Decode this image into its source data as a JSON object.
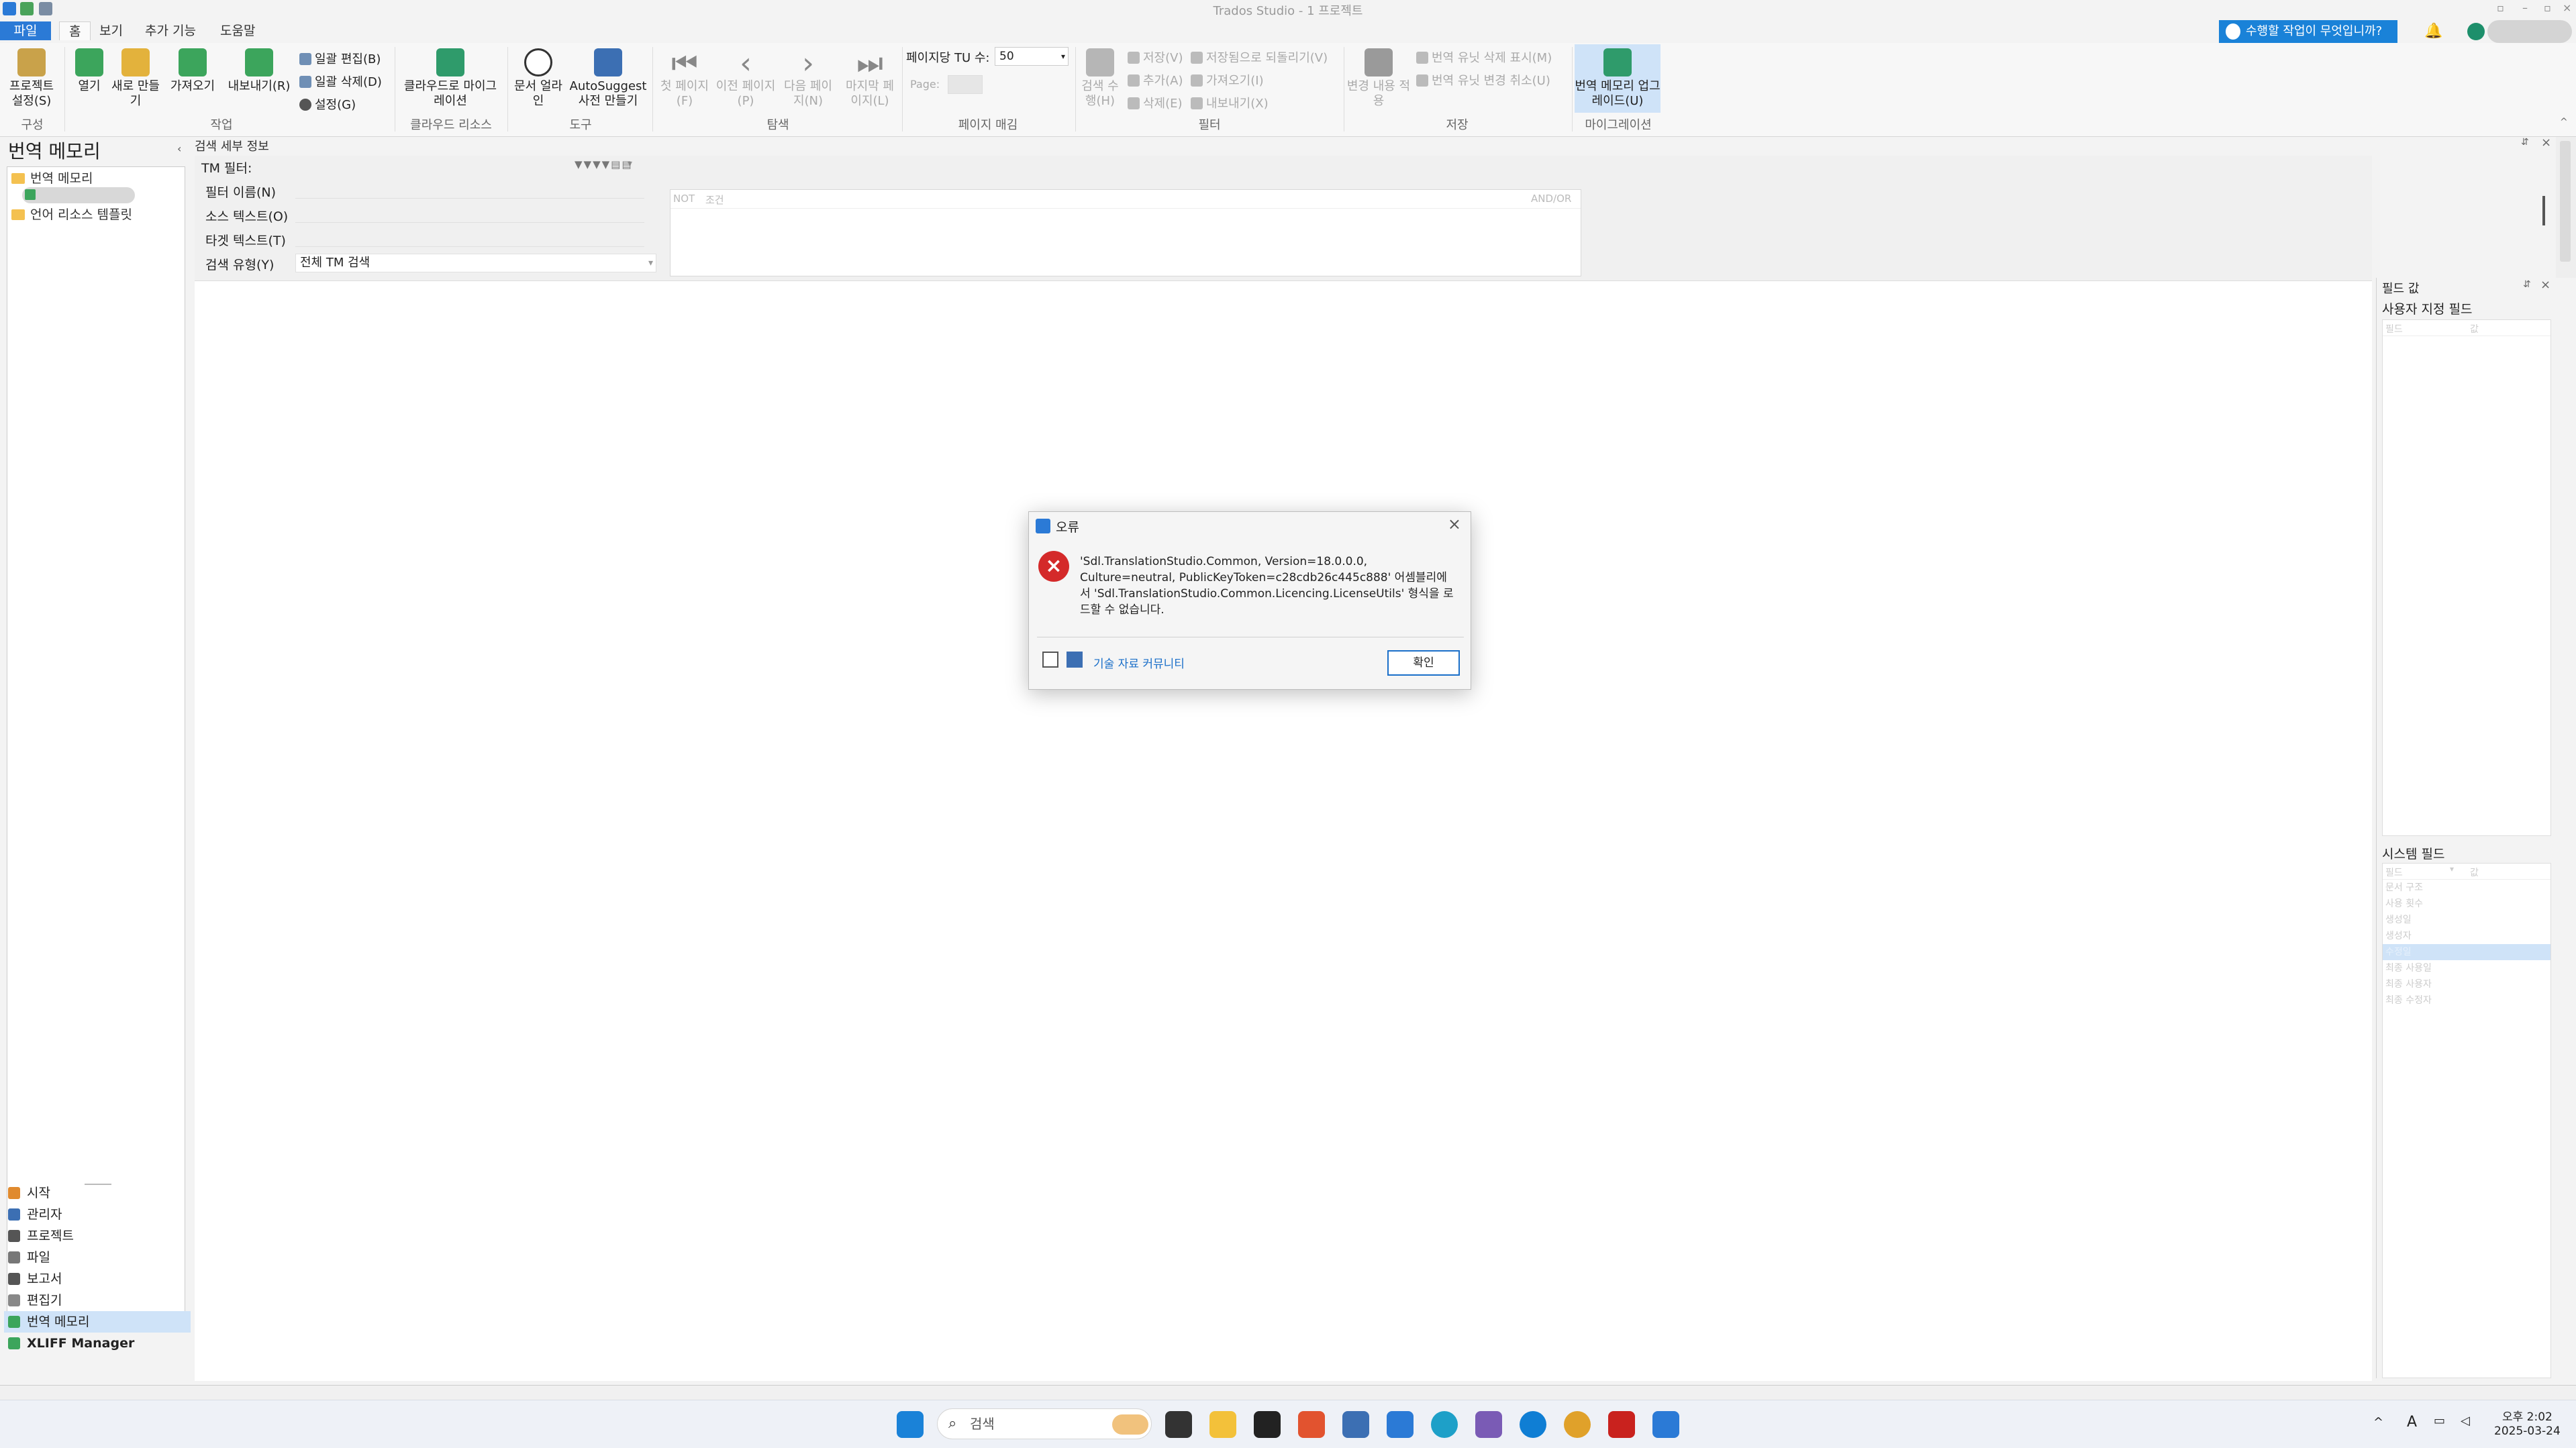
{
  "window": {
    "title": "Trados Studio - 1 프로젝트"
  },
  "menu": {
    "tabs": [
      "파일",
      "홈",
      "보기",
      "추가 기능",
      "도움말"
    ],
    "help_button": "수행할 작업이 무엇입니까?"
  },
  "ribbon": {
    "config": {
      "project_settings": "프로젝트 설정(S)",
      "group": "구성"
    },
    "tasks": {
      "open": "열기",
      "new": "새로 만들기",
      "import": "가져오기",
      "export": "내보내기(R)",
      "batch_edit": "일괄 편집(B)",
      "batch_delete": "일괄 삭제(D)",
      "settings": "설정(G)",
      "group": "작업"
    },
    "cloud": {
      "migrate": "클라우드로 마이그레이션",
      "group": "클라우드 리소스"
    },
    "tools": {
      "doc_align": "문서 얼라인",
      "autosuggest": "AutoSuggest 사전 만들기",
      "group": "도구"
    },
    "navigation": {
      "first": "첫 페이지(F)",
      "prev": "이전 페이지(P)",
      "next": "다음 페이지(N)",
      "last": "마지막 페이지(L)",
      "group": "탐색"
    },
    "paging": {
      "tu_per_page_label": "페이지당 TU 수:",
      "tu_per_page_value": "50",
      "page_label": "Page:",
      "group": "페이지 매김"
    },
    "filter": {
      "search": "검색 수행(H)",
      "save": "저장(V)",
      "add": "추가(A)",
      "delete": "삭제(E)",
      "revert": "저장됨으로 되돌리기(V)",
      "import": "가져오기(I)",
      "export": "내보내기(X)",
      "group": "필터"
    },
    "save": {
      "apply_changes": "변경 내용 적용",
      "show_deleted": "번역 유닛 삭제 표시(M)",
      "cancel_changes": "번역 유닛 변경 취소(U)",
      "group": "저장"
    },
    "migration": {
      "upgrade": "번역 메모리 업그레이드(U)",
      "group": "마이그레이션"
    }
  },
  "nav": {
    "title": "번역 메모리",
    "tree": [
      "번역 메모리",
      "언어 리소스 템플릿"
    ],
    "items": [
      "시작",
      "관리자",
      "프로젝트",
      "파일",
      "보고서",
      "편집기",
      "번역 메모리",
      "XLIFF Manager"
    ],
    "selected": "번역 메모리"
  },
  "search": {
    "header": "검색 세부 정보",
    "tm_filter_label": "TM 필터:",
    "filter_name": "필터 이름(N)",
    "source_text": "소스 텍스트(O)",
    "target_text": "타겟 텍스트(T)",
    "search_type_label": "검색 유형(Y)",
    "search_type_value": "전체 TM 검색",
    "cond_not": "NOT",
    "cond_condition": "조건",
    "cond_andor": "AND/OR"
  },
  "fields": {
    "title": "필드 값",
    "custom": "사용자 지정 필드",
    "custom_cols": [
      "필드",
      "값"
    ],
    "system": "시스템 필드",
    "system_cols": [
      "필드",
      "값"
    ],
    "system_rows": [
      "문서 구조",
      "사용 횟수",
      "생성일",
      "생성자",
      "수정일",
      "최종 사용일",
      "최종 사용자",
      "최종 수정자"
    ]
  },
  "dialog": {
    "title": "오류",
    "message": "'Sdl.TranslationStudio.Common, Version=18.0.0.0, Culture=neutral, PublicKeyToken=c28cdb26c445c888' 어셈블리에서 'Sdl.TranslationStudio.Common.Licencing.LicenseUtils' 형식을 로드할 수 없습니다.",
    "links": "기술 자료  커뮤니티",
    "ok": "확인"
  },
  "taskbar": {
    "search_placeholder": "검색",
    "time": "오후 2:02",
    "date": "2025-03-24",
    "ime": "A"
  }
}
